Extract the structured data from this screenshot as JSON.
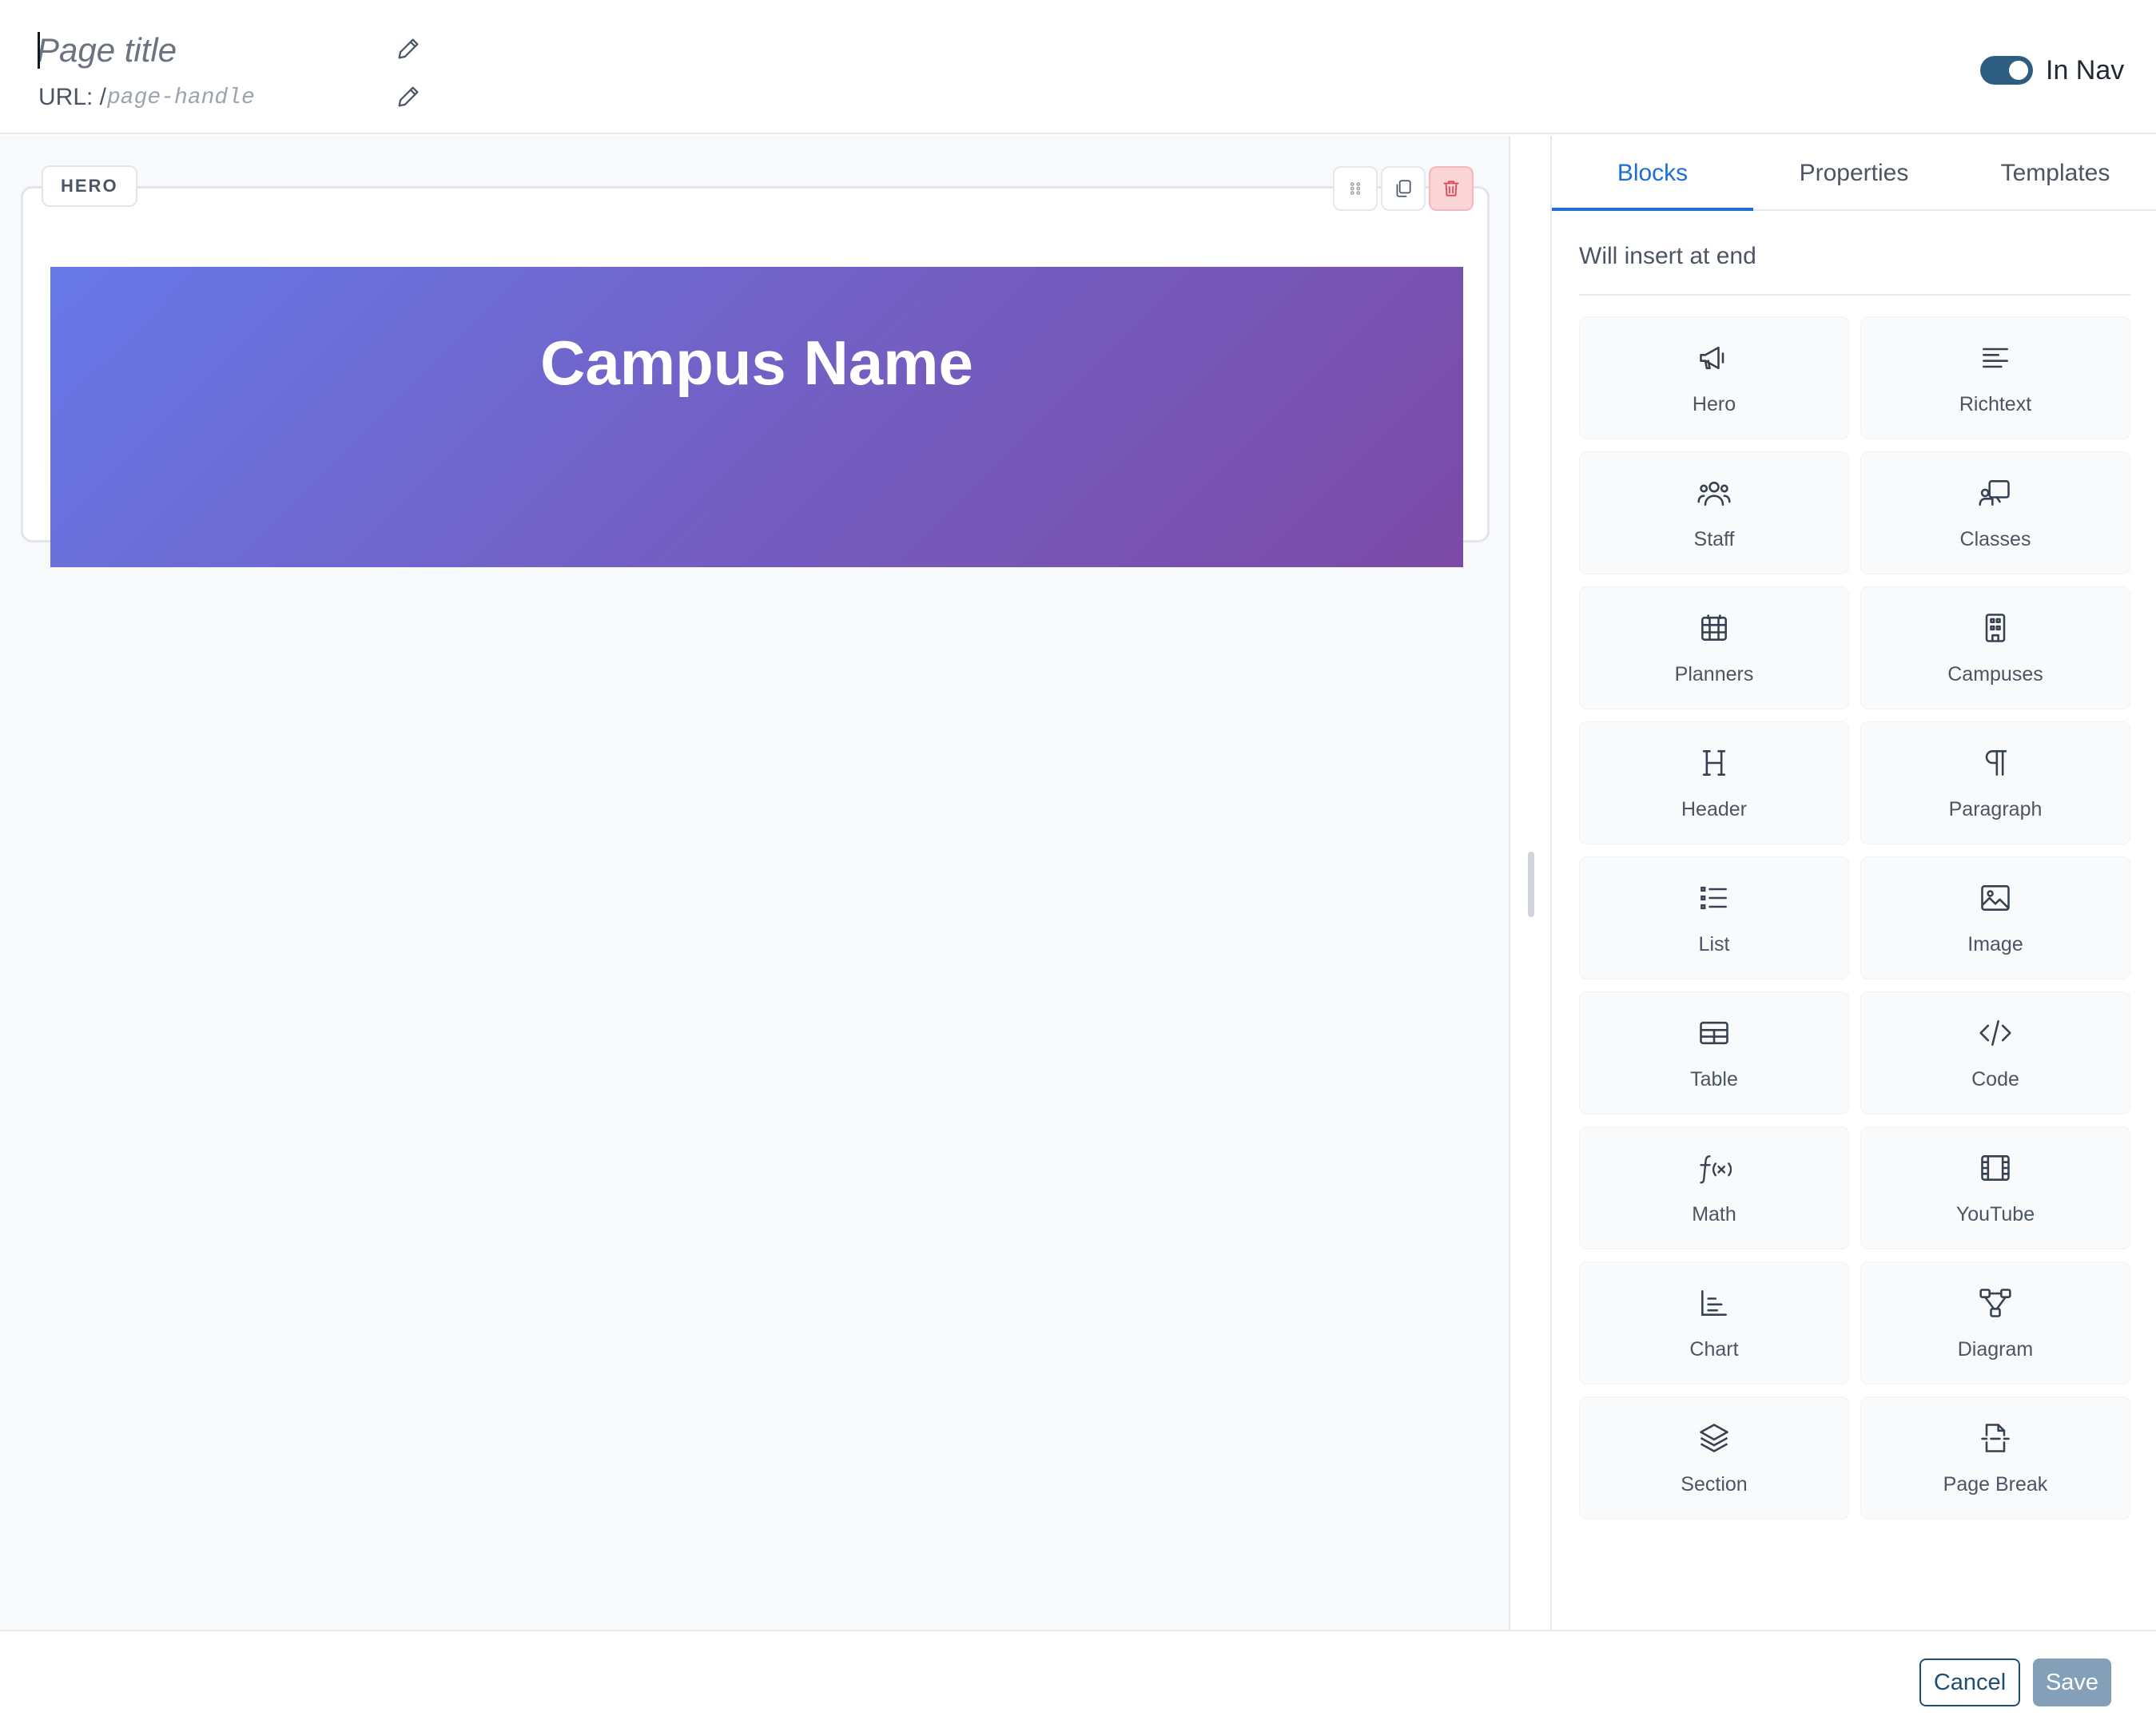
{
  "header": {
    "title_placeholder": "Page title",
    "url_label": "URL: /",
    "url_placeholder": "page-handle",
    "in_nav_label": "In Nav",
    "in_nav_enabled": true
  },
  "canvas": {
    "block_tag": "HERO",
    "hero_title": "Campus Name"
  },
  "panel": {
    "tabs": [
      {
        "label": "Blocks",
        "active": true
      },
      {
        "label": "Properties",
        "active": false
      },
      {
        "label": "Templates",
        "active": false
      }
    ],
    "insert_note": "Will insert at end",
    "blocks": [
      {
        "label": "Hero",
        "icon": "megaphone-icon"
      },
      {
        "label": "Richtext",
        "icon": "text-align-icon"
      },
      {
        "label": "Staff",
        "icon": "users-icon"
      },
      {
        "label": "Classes",
        "icon": "presentation-icon"
      },
      {
        "label": "Planners",
        "icon": "calendar-grid-icon"
      },
      {
        "label": "Campuses",
        "icon": "building-icon"
      },
      {
        "label": "Header",
        "icon": "heading-icon"
      },
      {
        "label": "Paragraph",
        "icon": "pilcrow-icon"
      },
      {
        "label": "List",
        "icon": "list-icon"
      },
      {
        "label": "Image",
        "icon": "image-icon"
      },
      {
        "label": "Table",
        "icon": "table-icon"
      },
      {
        "label": "Code",
        "icon": "code-icon"
      },
      {
        "label": "Math",
        "icon": "function-icon"
      },
      {
        "label": "YouTube",
        "icon": "film-icon"
      },
      {
        "label": "Chart",
        "icon": "chart-icon"
      },
      {
        "label": "Diagram",
        "icon": "diagram-icon"
      },
      {
        "label": "Section",
        "icon": "layers-icon"
      },
      {
        "label": "Page Break",
        "icon": "page-break-icon"
      }
    ]
  },
  "footer": {
    "cancel_label": "Cancel",
    "save_label": "Save"
  },
  "colors": {
    "accent": "#1d6fd6",
    "toggle": "#2d5d80",
    "save_disabled": "#84a0b8",
    "danger_bg": "#fad4d6",
    "hero_gradient_start": "#6779e8",
    "hero_gradient_end": "#7b4aa6"
  }
}
